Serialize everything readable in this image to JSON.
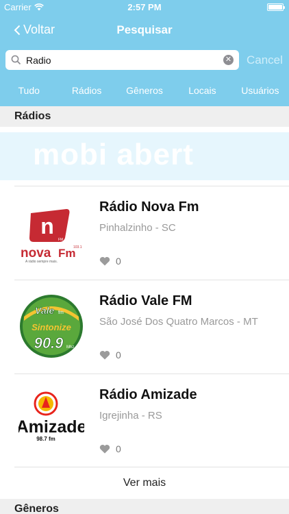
{
  "status_bar": {
    "carrier": "Carrier",
    "time": "2:57 PM",
    "wifi_icon": "wifi-icon",
    "battery_icon": "battery-icon"
  },
  "nav": {
    "back_label": "Voltar",
    "back_icon": "chevron-left-icon",
    "title": "Pesquisar"
  },
  "search": {
    "value": "Radio",
    "placeholder": "",
    "cancel_label": "Cancel",
    "search_icon": "magnifier-icon",
    "clear_icon": "clear-x-icon"
  },
  "scope_tabs": [
    {
      "label": "Tudo"
    },
    {
      "label": "Rádios"
    },
    {
      "label": "Gêneros"
    },
    {
      "label": "Locais"
    },
    {
      "label": "Usuários"
    }
  ],
  "sections": {
    "radios": "Rádios",
    "generos": "Gêneros"
  },
  "banner": {
    "text": "mobi abert"
  },
  "radios": [
    {
      "name": "Rádio Nova Fm",
      "location": "Pinhalzinho - SC",
      "likes": "0",
      "logo": {
        "main": "nova",
        "suffix": "Fm",
        "freq": "103.1",
        "tagline": "A rádio sempre mais.",
        "mark": "n",
        "mark_sub": "FM"
      }
    },
    {
      "name": "Rádio Vale FM",
      "location": "São José Dos Quatro Marcos - MT",
      "likes": "0",
      "logo": {
        "top": "Vale",
        "top_sub": "fm",
        "middle": "Sintonize",
        "freq": "90.9",
        "unit": "Mhz"
      }
    },
    {
      "name": "Rádio Amizade",
      "location": "Igrejinha - RS",
      "likes": "0",
      "logo": {
        "main": "Amizade",
        "freq": "98.7 fm"
      }
    }
  ],
  "ver_mais": "Ver mais",
  "colors": {
    "header": "#7ecdec",
    "section_bg": "#efefef",
    "banner_bg": "#e6f6fd"
  }
}
